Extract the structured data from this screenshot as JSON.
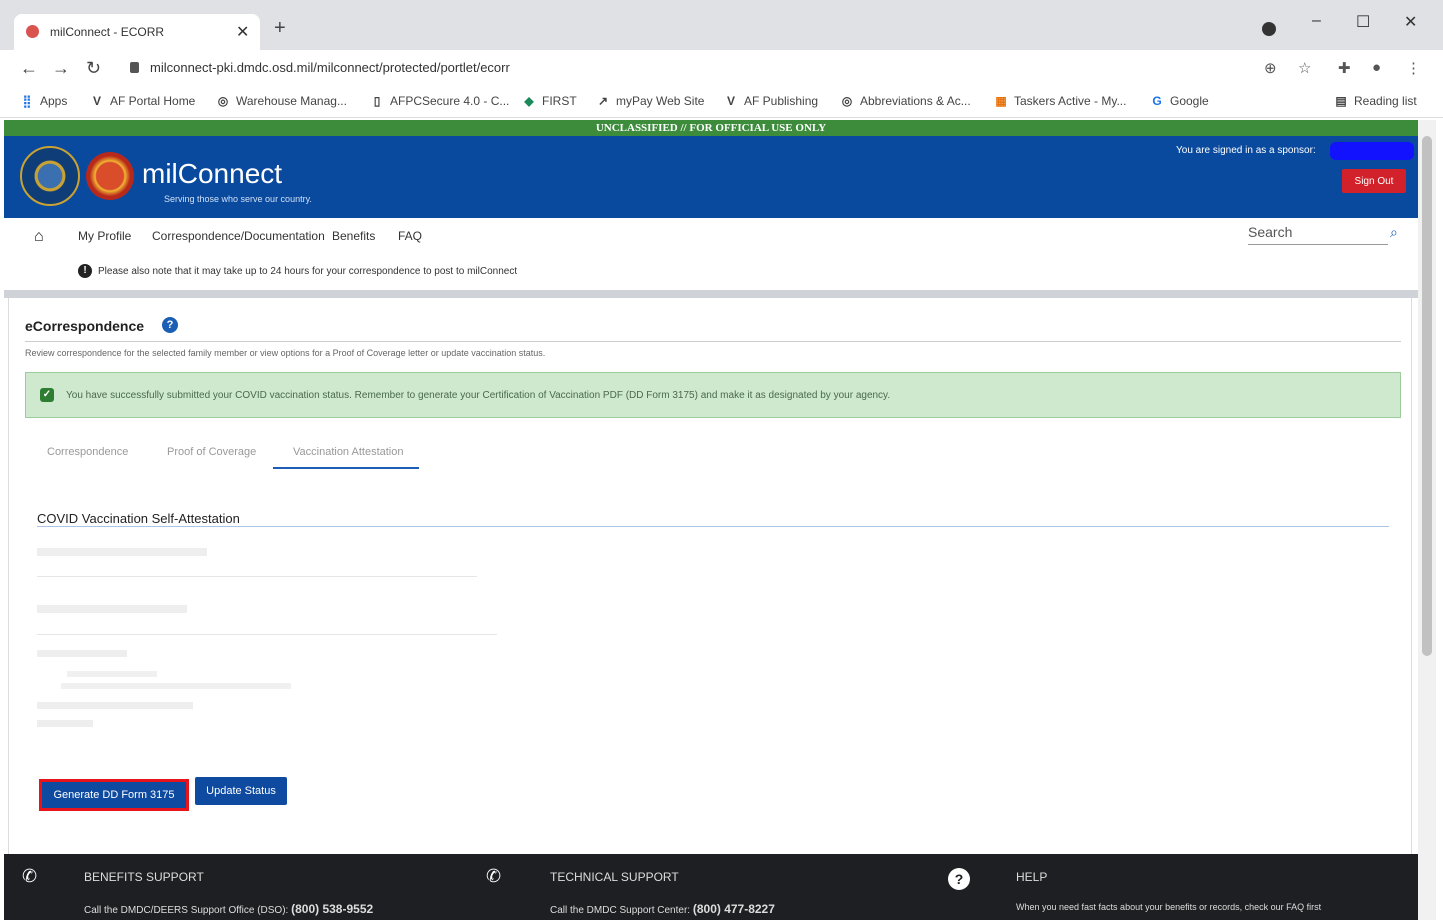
{
  "browser": {
    "tab_title": "milConnect - ECORR",
    "address": "milconnect-pki.dmdc.osd.mil/milconnect/protected/portlet/ecorr",
    "bookmarks": [
      "Apps",
      "AF Portal Home",
      "Warehouse Manag...",
      "AFPCSecure 4.0 - C...",
      "FIRST",
      "myPay Web Site",
      "AF Publishing",
      "Abbreviations & Ac...",
      "Taskers Active - My...",
      "Google"
    ],
    "reading_list": "Reading list"
  },
  "classification": "UNCLASSIFIED // FOR OFFICIAL USE ONLY",
  "header": {
    "brand": "milConnect",
    "tagline": "Serving those who serve our country.",
    "sponsor_text": "You are signed in as a sponsor:",
    "sign_out": "Sign Out"
  },
  "nav": {
    "items": [
      "My Profile",
      "Correspondence/Documentation",
      "Benefits",
      "FAQ"
    ],
    "search_placeholder": "Search"
  },
  "notice": "Please also note that it may take up to 24 hours for your correspondence to post to milConnect",
  "main": {
    "title": "eCorrespondence",
    "description": "Review correspondence for the selected family member or view options for a Proof of Coverage letter or update vaccination status.",
    "alert": "You have successfully submitted your COVID vaccination status. Remember to generate your Certification of Vaccination PDF (DD Form 3175) and make it as designated by your agency.",
    "tabs": [
      "Correspondence",
      "Proof of Coverage",
      "Vaccination Attestation"
    ],
    "section_title": "COVID Vaccination Self-Attestation",
    "generate_button": "Generate DD Form 3175",
    "update_button": "Update Status"
  },
  "footer": {
    "benefits_heading": "BENEFITS SUPPORT",
    "benefits_text": "Call the DMDC/DEERS Support Office (DSO):",
    "benefits_phone": "(800) 538-9552",
    "technical_heading": "TECHNICAL SUPPORT",
    "technical_text": "Call the DMDC Support Center:",
    "technical_phone": "(800) 477-8227",
    "help_heading": "HELP",
    "help_text": "When you need fast facts about your benefits or records, check our FAQ first"
  }
}
